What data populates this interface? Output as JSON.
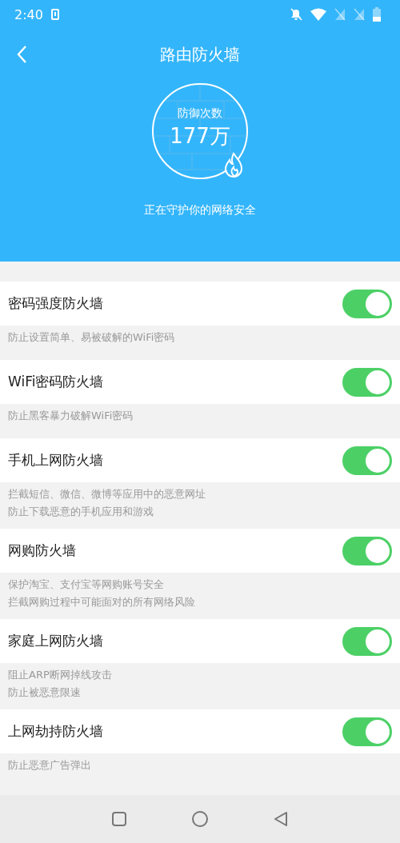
{
  "status_bar": {
    "time": "2:40"
  },
  "header": {
    "title": "路由防火墙",
    "counter_label": "防御次数",
    "counter_value": "177万",
    "status": "正在守护你的网络安全"
  },
  "items": [
    {
      "title": "密码强度防火墙",
      "on": true,
      "description": [
        "防止设置简单、易被破解的WiFi密码"
      ]
    },
    {
      "title": "WiFi密码防火墙",
      "on": true,
      "description": [
        "防止黑客暴力破解WiFi密码"
      ]
    },
    {
      "title": "手机上网防火墙",
      "on": true,
      "description": [
        "拦截短信、微信、微博等应用中的恶意网址",
        "防止下载恶意的手机应用和游戏"
      ]
    },
    {
      "title": "网购防火墙",
      "on": true,
      "description": [
        "保护淘宝、支付宝等网购账号安全",
        "拦截网购过程中可能面对的所有网络风险"
      ]
    },
    {
      "title": "家庭上网防火墙",
      "on": true,
      "description": [
        "阻止ARP断网掉线攻击",
        "防止被恶意限速"
      ]
    },
    {
      "title": "上网劫持防火墙",
      "on": true,
      "description": [
        "防止恶意广告弹出"
      ]
    }
  ]
}
